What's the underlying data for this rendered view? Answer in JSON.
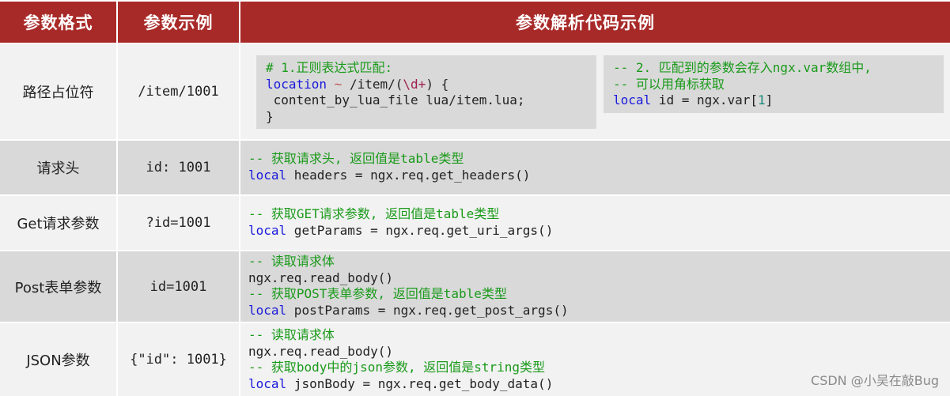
{
  "header": {
    "col_format": "参数格式",
    "col_example": "参数示例",
    "col_code": "参数解析代码示例"
  },
  "colors": {
    "header_bg": "#a82a28",
    "row_light": "#f2f2f2",
    "row_gray": "#d9d9d9",
    "comment": "#1a9a1a",
    "keyword": "#1a1adc"
  },
  "rows": [
    {
      "format": "路径占位符",
      "example": "/item/1001",
      "code_box_1": {
        "comment": "# 1.正则表达式匹配:",
        "line2_kw": "location",
        "line2_op": " ~ ",
        "line2_text": "/item/(",
        "line2_re": "\\d+",
        "line2_end": ") {",
        "line3": " content_by_lua_file lua/item.lua;",
        "line4": "}"
      },
      "code_box_2": {
        "comment1": "-- 2. 匹配到的参数会存入ngx.var数组中,",
        "comment2": "-- 可以用角标获取",
        "line3_kw": "local",
        "line3_text": " id = ngx.var[",
        "line3_num": "1",
        "line3_end": "]"
      }
    },
    {
      "format": "请求头",
      "example": "id: 1001",
      "code": {
        "comment": "-- 获取请求头, 返回值是table类型",
        "kw": "local",
        "text": " headers = ngx.req.get_headers()"
      }
    },
    {
      "format": "Get请求参数",
      "example": "?id=1001",
      "code": {
        "comment": "-- 获取GET请求参数, 返回值是table类型",
        "kw": "local",
        "text": " getParams = ngx.req.get_uri_args()"
      }
    },
    {
      "format": "Post表单参数",
      "example": "id=1001",
      "code": {
        "comment1": "-- 读取请求体",
        "line2": "ngx.req.read_body()",
        "comment2": "-- 获取POST表单参数, 返回值是table类型",
        "kw": "local",
        "text": " postParams = ngx.req.get_post_args()"
      }
    },
    {
      "format": "JSON参数",
      "example": "{\"id\": 1001}",
      "code": {
        "comment1": "-- 读取请求体",
        "line2": "ngx.req.read_body()",
        "comment2": "-- 获取body中的json参数, 返回值是string类型",
        "kw": "local",
        "text": " jsonBody = ngx.req.get_body_data()"
      }
    }
  ],
  "watermark": "CSDN @小吴在敲Bug"
}
